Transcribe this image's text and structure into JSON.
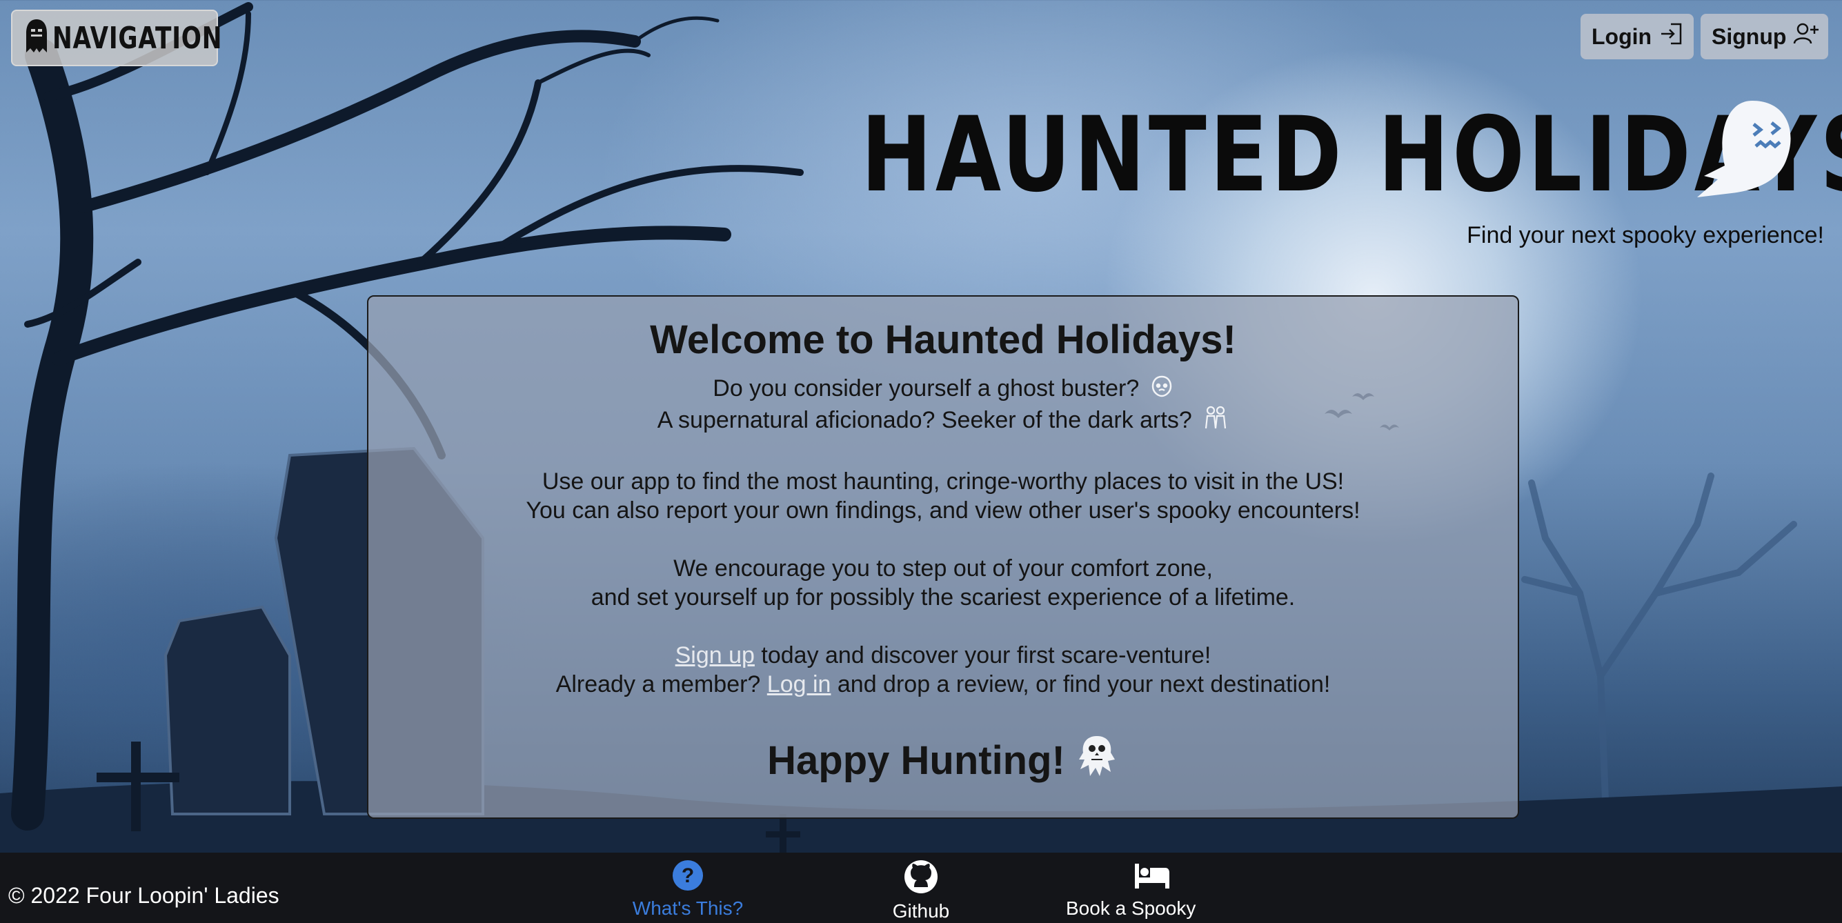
{
  "nav": {
    "label": "NAVIGATION",
    "icon": "ghost-icon"
  },
  "auth": {
    "login_label": "Login",
    "signup_label": "Signup",
    "login_icon": "login-icon",
    "signup_icon": "person-add-icon"
  },
  "header": {
    "logo_text": "HAUNTED HOLIDAYS",
    "logo_icon": "ghost-icon",
    "tagline": "Find your next spooky experience!"
  },
  "welcome": {
    "title": "Welcome to Haunted Holidays!",
    "p1_line1": "Do you consider yourself a ghost buster?",
    "p1_line2": "A supernatural aficionado? Seeker of the dark arts?",
    "p2_line1": "Use our app to find the most haunting, cringe-worthy places to visit in the US!",
    "p2_line2": "You can also report your own findings, and view other user's spooky encounters!",
    "p3_line1": "We encourage you to step out of your comfort zone,",
    "p3_line2": "and set yourself up for possibly the scariest experience of a lifetime.",
    "signup_link": "Sign up",
    "p4_line1_rest": " today and discover your first scare-venture!",
    "p4_line2_pre": "Already a member? ",
    "login_link": "Log in",
    "p4_line2_rest": " and drop a review, or find your next destination!",
    "closing": "Happy Hunting!"
  },
  "footer": {
    "copyright": "© 2022 Four Loopin' Ladies",
    "items": [
      {
        "label": "What's This?",
        "icon": "question-circle-icon",
        "active": true
      },
      {
        "label": "Github",
        "icon": "github-icon"
      },
      {
        "label": "Book a Spooky Stay",
        "icon": "bed-icon"
      }
    ]
  },
  "colors": {
    "footer_bg": "#141519",
    "active_link": "#3b7ddd",
    "card_bg": "#969fb2"
  }
}
